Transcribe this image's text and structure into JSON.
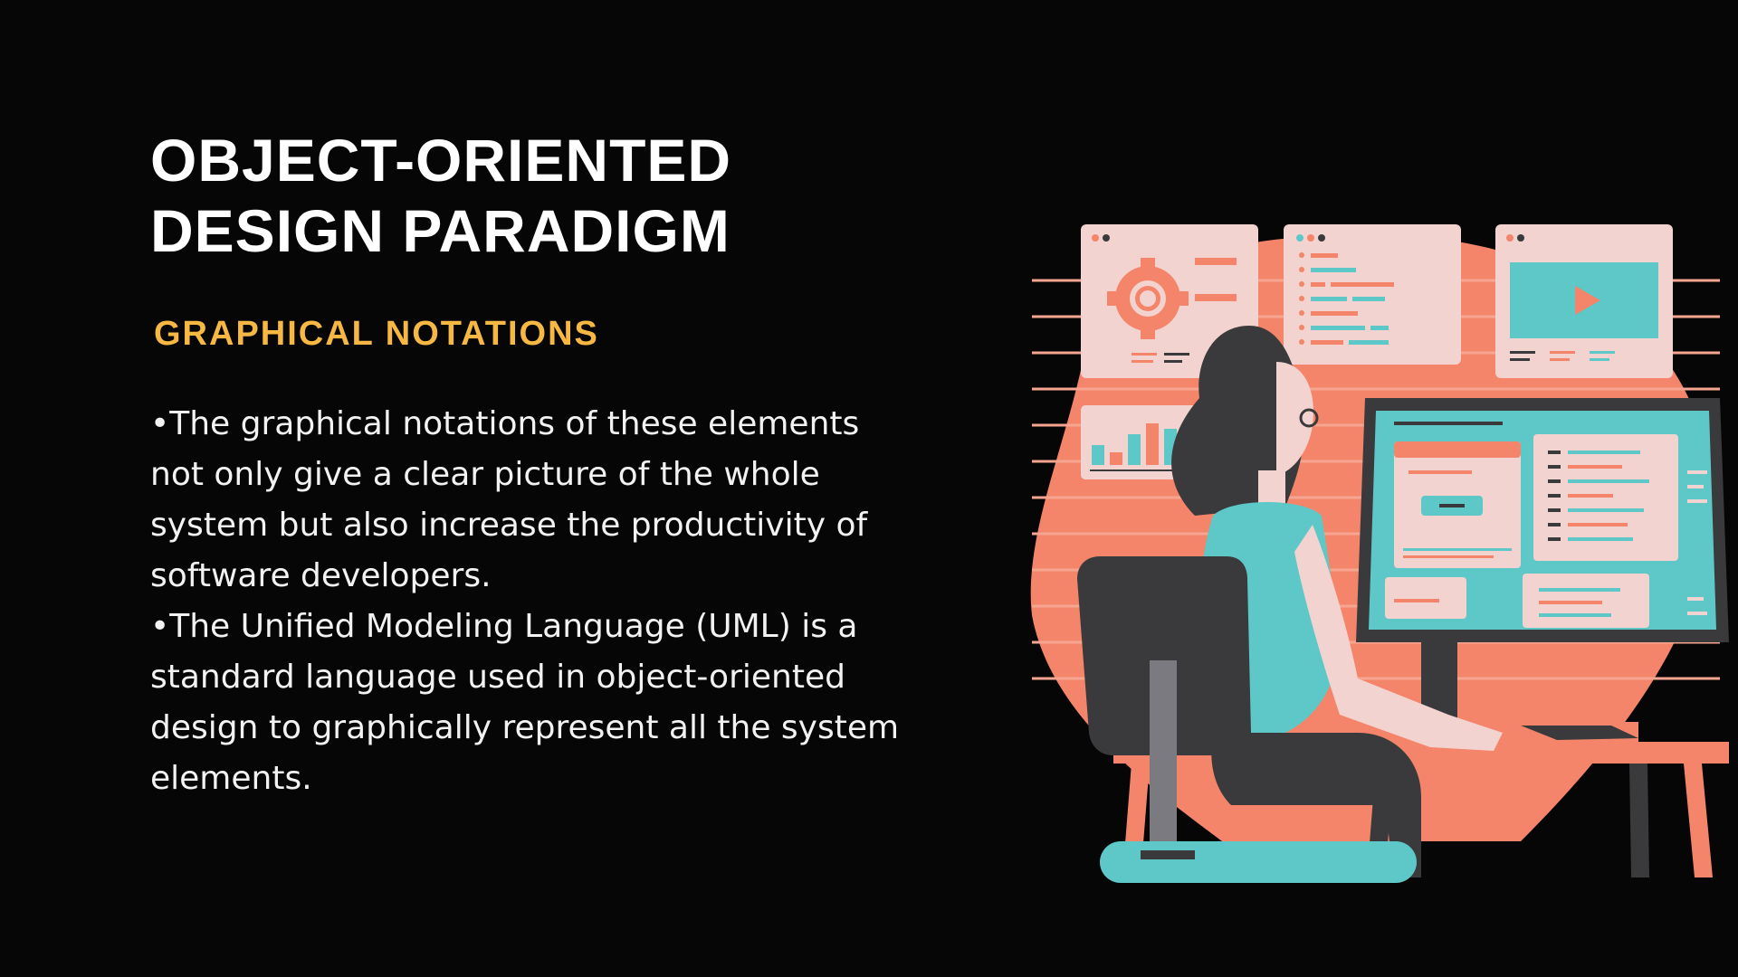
{
  "slide": {
    "title_line1": "OBJECT-ORIENTED",
    "title_line2": "DESIGN PARADIGM",
    "subtitle": "GRAPHICAL NOTATIONS",
    "paragraphs": [
      "•The graphical notations of these elements not only give a clear picture of the whole system but also increase the productivity of software developers.",
      "•The Unified Modeling Language (UML) is a standard language used in object-oriented design to graphically represent all the system elements."
    ]
  },
  "illustration": {
    "name": "developer-at-computer-illustration",
    "colors": {
      "background": "#060606",
      "accent_coral": "#f4846a",
      "panel_pink": "#f3d3d0",
      "teal": "#5ec8c9",
      "dark": "#3a3a3c",
      "title_text": "#ffffff",
      "subtitle_text": "#f6b743"
    }
  }
}
